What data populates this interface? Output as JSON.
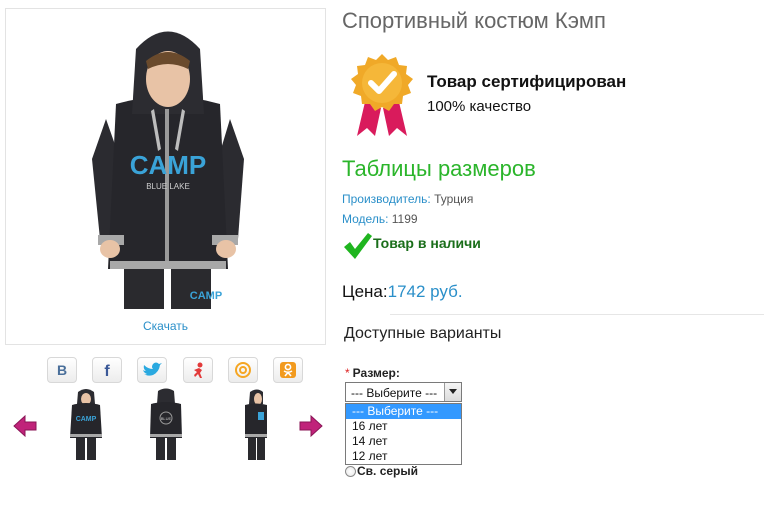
{
  "product": {
    "title": "Спортивный костюм Кэмп",
    "download_label": "Скачать"
  },
  "certificate": {
    "title": "Товар сертифицирован",
    "subtitle": "100% качество",
    "badge_color": "#f0a928",
    "ribbon_color": "#d91b5c"
  },
  "size_tables_link": "Таблицы размеров",
  "attributes": {
    "manufacturer_key": "Производитель:",
    "manufacturer_value": "Турция",
    "model_key": "Модель:",
    "model_value": "1199"
  },
  "stock": {
    "label": "Товар в наличи",
    "icon": "checkmark-icon"
  },
  "price": {
    "label": "Цена:",
    "value": "1742 руб."
  },
  "options": {
    "title": "Доступные варианты",
    "size": {
      "required_mark": "*",
      "label": "Размер:",
      "selected": "--- Выберите ---",
      "items": [
        "--- Выберите ---",
        "16 лет",
        "14 лет",
        "12 лет"
      ]
    },
    "color": {
      "label": "Св. серый"
    }
  },
  "share": {
    "buttons": [
      "vkontakte-icon",
      "facebook-icon",
      "twitter-icon",
      "moimir-icon",
      "mail-icon",
      "odnoklassniki-icon"
    ]
  },
  "colors": {
    "accent_blue": "#2a8fc9",
    "green": "#2bb52b",
    "nav_arrow": "#c0237a"
  }
}
